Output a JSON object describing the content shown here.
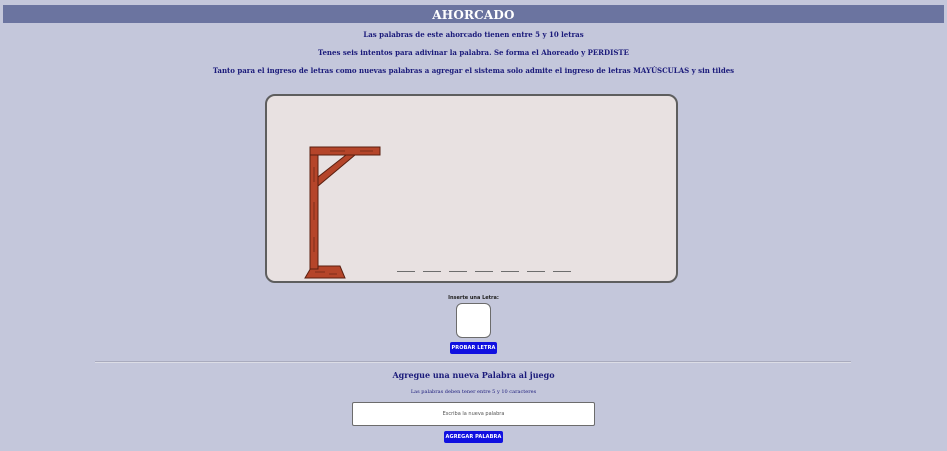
{
  "header": {
    "title": "AHORCADO"
  },
  "instructions": {
    "line1": "Las palabras de este ahorcado tienen entre 5 y 10 letras",
    "line2": "Tenes seis intentos para adivinar la palabra. Se forma el Ahoreado y PERDISTE",
    "line3": "Tanto para el ingreso de letras como nuevas palabras a agregar el sistema solo admite el ingreso de letras MAYÚSCULAS y sin tildes"
  },
  "game": {
    "letter_slots": 7,
    "input_label": "Inserte una Letra:",
    "letter_value": "",
    "try_button": "PROBAR LETRA"
  },
  "add_word": {
    "title": "Agregue una nueva Palabra al juego",
    "subtitle": "Las palabras deben tener entre 5 y 10 caracteres",
    "placeholder": "Escriba la nueva palabra",
    "button": "AGREGAR PALABRA"
  },
  "colors": {
    "background": "#c4c7db",
    "header": "#6b74a0",
    "text": "#1a1a7a",
    "button": "#1010e0",
    "gallows_wood": "#b5452a",
    "board": "#e8e1e1"
  },
  "icons": {
    "gallows": "gallows-icon"
  }
}
